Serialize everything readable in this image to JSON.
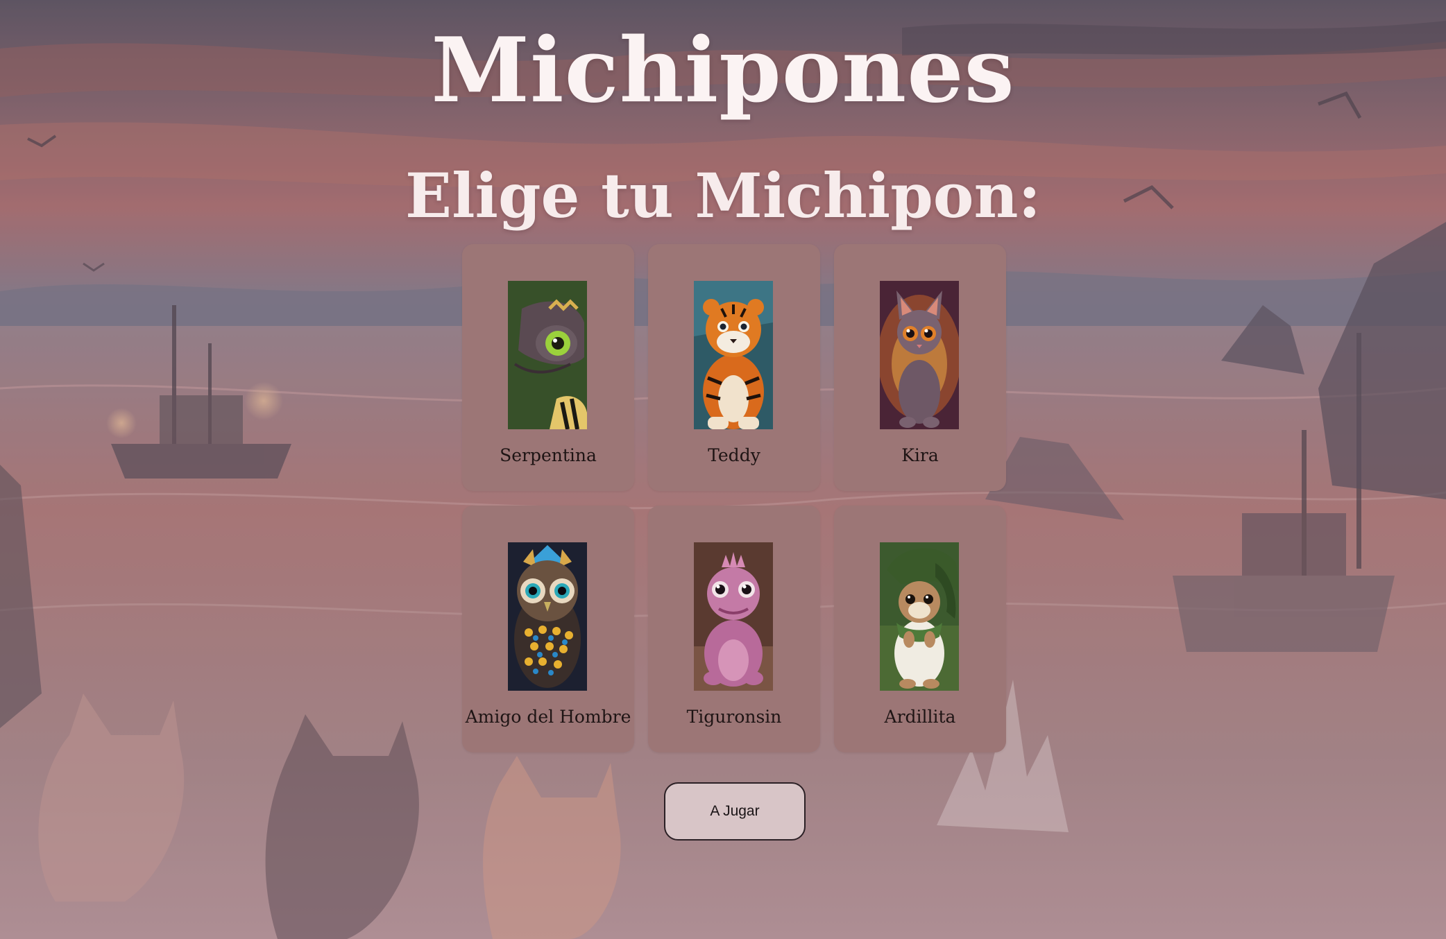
{
  "header": {
    "title": "Michipones",
    "subtitle": "Elige tu Michipon:"
  },
  "characters": [
    {
      "name": "Serpentina",
      "icon": "snake-portrait"
    },
    {
      "name": "Teddy",
      "icon": "tiger-cub-portrait"
    },
    {
      "name": "Kira",
      "icon": "kitten-portrait"
    },
    {
      "name": "Amigo del Hombre",
      "icon": "owl-portrait"
    },
    {
      "name": "Tiguronsin",
      "icon": "pink-dragon-portrait"
    },
    {
      "name": "Ardillita",
      "icon": "squirrel-portrait"
    }
  ],
  "actions": {
    "play_label": "A Jugar"
  },
  "colors": {
    "card_background": "#9c7676",
    "title_text": "#fbf3f3",
    "button_background": "#d8c5c7"
  }
}
